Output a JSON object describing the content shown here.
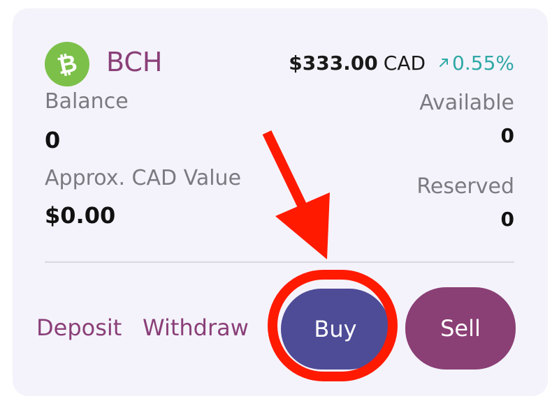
{
  "asset": {
    "symbol": "BCH",
    "icon": "bitcoin-cash-icon",
    "icon_color": "#7cc04a",
    "price": "$333.00",
    "currency": "CAD",
    "change_icon": "trend-up-arrow-icon",
    "change_percent": "0.55%"
  },
  "balance": {
    "label": "Balance",
    "value": "0",
    "cad_label": "Approx. CAD Value",
    "cad_value": "$0.00"
  },
  "side": {
    "available_label": "Available",
    "available_value": "0",
    "reserved_label": "Reserved",
    "reserved_value": "0"
  },
  "actions": {
    "deposit": "Deposit",
    "withdraw": "Withdraw",
    "buy": "Buy",
    "sell": "Sell"
  },
  "annotation": {
    "arrow_icon": "red-arrow-icon",
    "highlight": "red-circle-highlight",
    "color": "#ff1a00"
  },
  "colors": {
    "brand_purple": "#8a3f78",
    "buy_button": "#4e4c97",
    "sell_button": "#8a3f75",
    "positive_change": "#2fa8a6",
    "card_background": "#f4f3fb"
  }
}
